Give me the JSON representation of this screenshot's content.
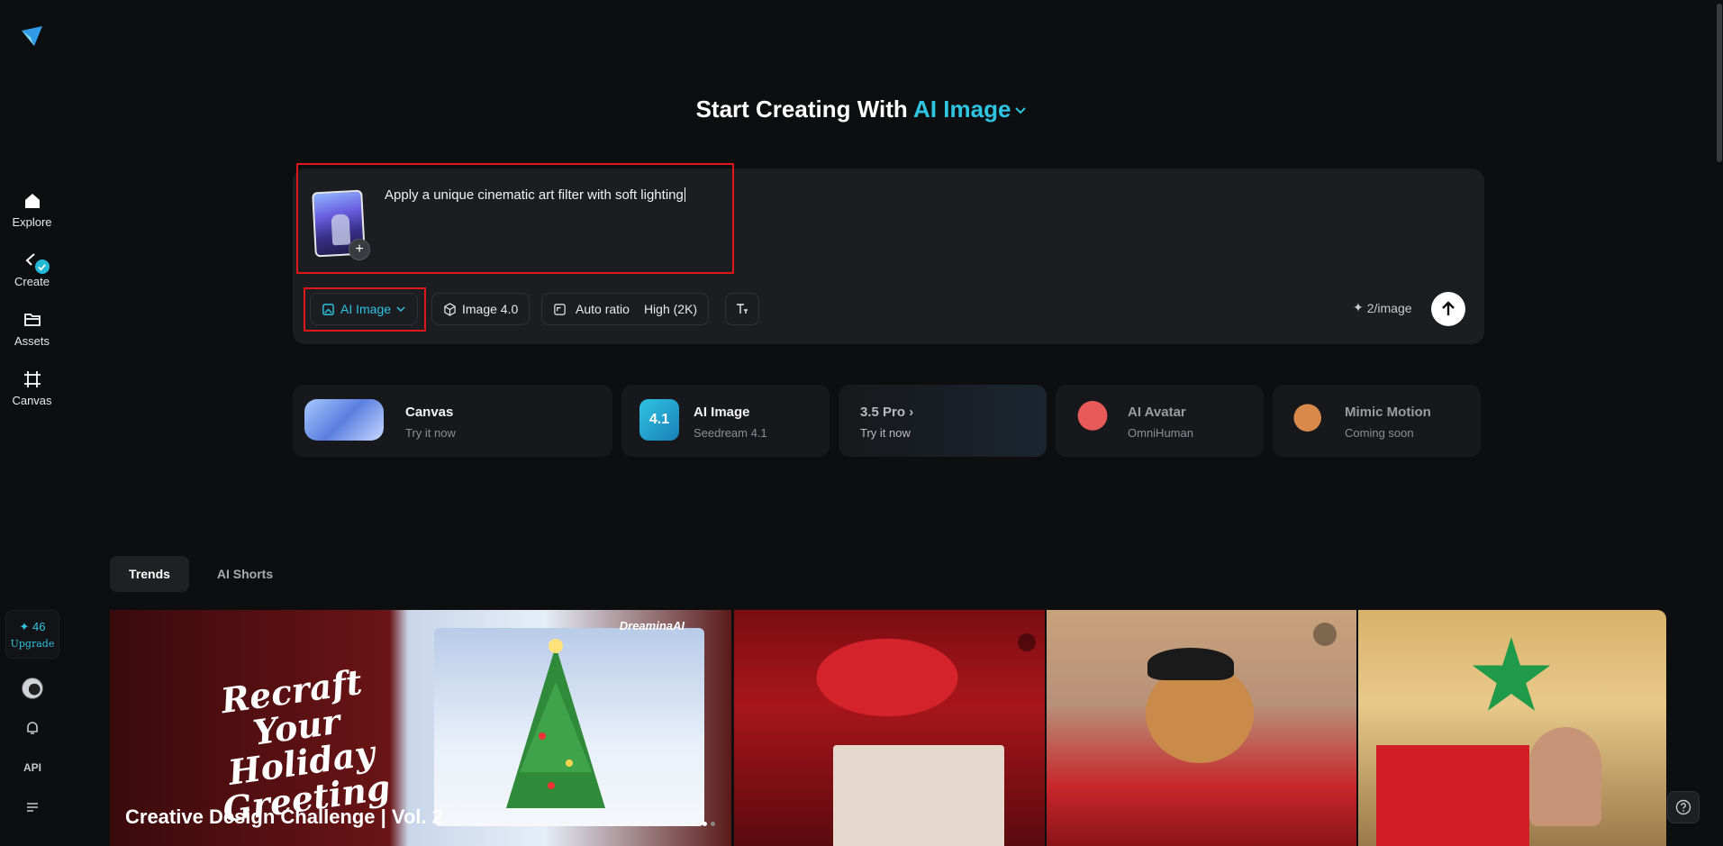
{
  "sidebar": {
    "items": [
      {
        "label": "Explore",
        "icon": "home-icon"
      },
      {
        "label": "Create",
        "icon": "create-icon"
      },
      {
        "label": "Assets",
        "icon": "folder-icon"
      },
      {
        "label": "Canvas",
        "icon": "canvas-icon"
      }
    ],
    "credits": "✦ 46",
    "upgrade": "Upgrade",
    "api": "API"
  },
  "header": {
    "title": "Start Creating With",
    "mode": "AI Image"
  },
  "composer": {
    "prompt": "Apply a unique cinematic art filter with soft lighting",
    "mode_label": "AI Image",
    "model_label": "Image 4.0",
    "ratio_label": "Auto ratio",
    "quality_label": "High (2K)",
    "cost": "2/image"
  },
  "features": [
    {
      "title": "Canvas",
      "subtitle": "Try it now"
    },
    {
      "title": "AI Image",
      "subtitle": "Seedream 4.1",
      "badge": "4.1"
    },
    {
      "title": "3.5 Pro",
      "subtitle": "Try it now"
    },
    {
      "title": "AI Avatar",
      "subtitle": "OmniHuman"
    },
    {
      "title": "Mimic Motion",
      "subtitle": "Coming soon"
    }
  ],
  "tabs": [
    "Trends",
    "AI Shorts"
  ],
  "gallery": {
    "banner_title": "Recraft Your Holiday Greeting",
    "banner_caption": "Creative Design Challenge | Vol. 2",
    "brand": "DreaminaAI"
  },
  "colors": {
    "accent": "#2ec4e2",
    "highlight": "#e0161b",
    "background": "#0d0e10"
  }
}
